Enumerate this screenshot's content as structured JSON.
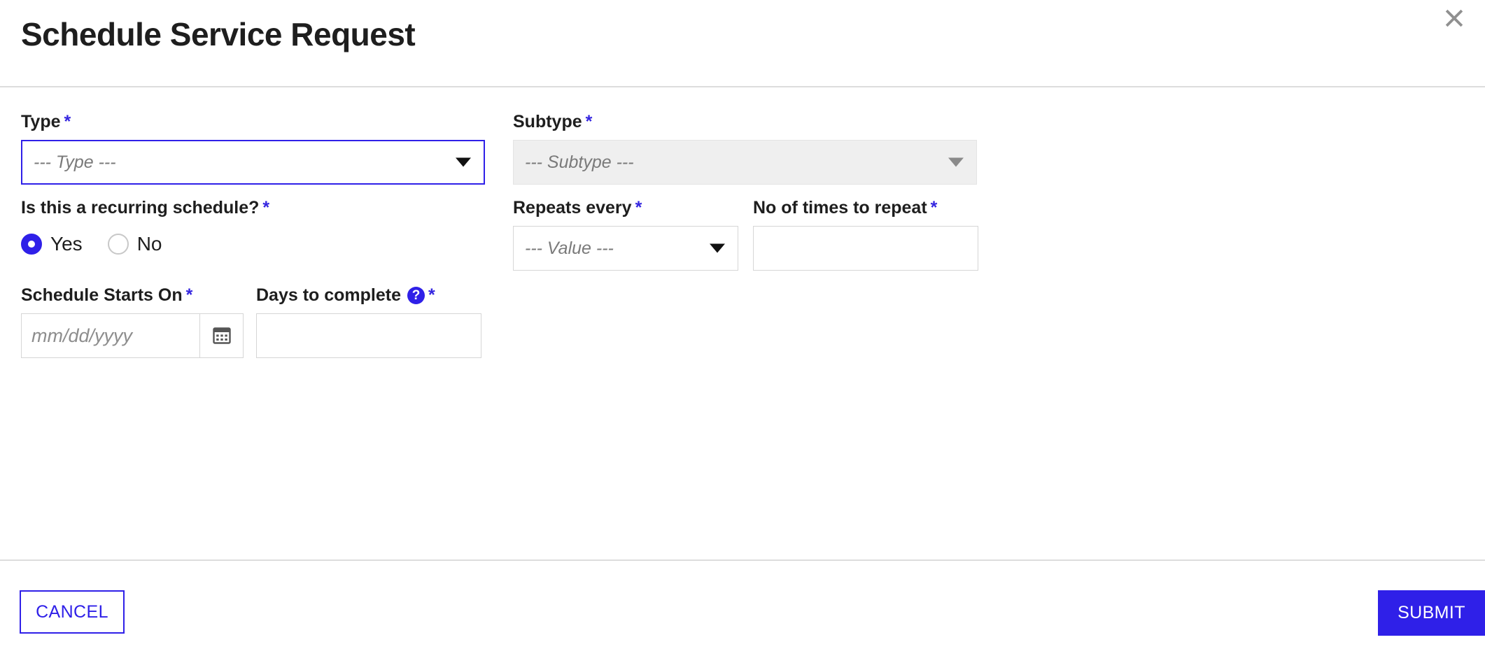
{
  "dialog": {
    "title": "Schedule Service Request",
    "close_icon": "close-icon"
  },
  "accent_color": "#2f20e8",
  "form": {
    "required_marker": "*",
    "type": {
      "label": "Type",
      "placeholder": "--- Type ---",
      "state": "focused",
      "icon": "chevron-down-icon"
    },
    "subtype": {
      "label": "Subtype",
      "placeholder": "--- Subtype ---",
      "state": "disabled",
      "icon": "chevron-down-icon"
    },
    "recurring": {
      "label": "Is this a recurring schedule?",
      "options": [
        {
          "label": "Yes",
          "checked": true
        },
        {
          "label": "No",
          "checked": false
        }
      ]
    },
    "repeats_every": {
      "label": "Repeats every",
      "placeholder": "--- Value ---",
      "icon": "chevron-down-icon"
    },
    "no_of_times": {
      "label": "No of times to repeat",
      "value": "",
      "placeholder": ""
    },
    "schedule_starts_on": {
      "label": "Schedule Starts On",
      "placeholder": "mm/dd/yyyy",
      "value": "",
      "icon": "calendar-icon"
    },
    "days_to_complete": {
      "label": "Days to complete",
      "value": "",
      "placeholder": "",
      "help_icon": "help-circle-icon",
      "help_glyph": "?"
    }
  },
  "footer": {
    "cancel_label": "CANCEL",
    "submit_label": "SUBMIT"
  }
}
